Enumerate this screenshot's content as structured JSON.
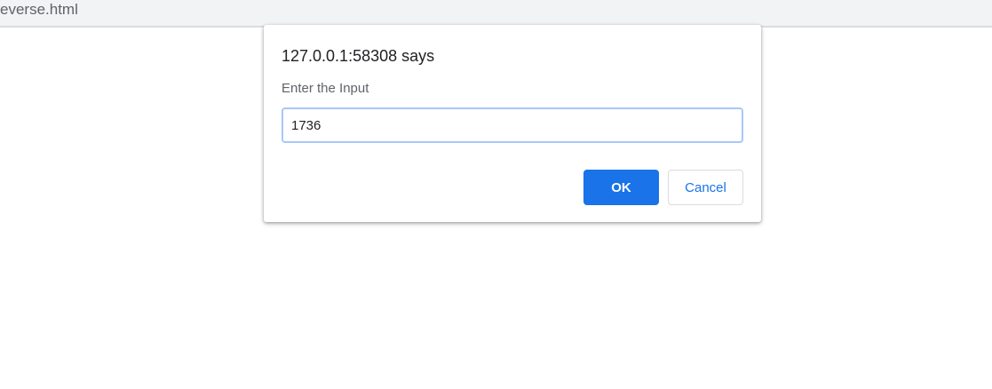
{
  "browser": {
    "address_text": "everse.html"
  },
  "dialog": {
    "title": "127.0.0.1:58308 says",
    "message": "Enter the Input",
    "input_value": "1736",
    "ok_label": "OK",
    "cancel_label": "Cancel"
  },
  "colors": {
    "accent": "#1a73e8",
    "input_focus_border": "#a8c7fa",
    "toolbar_bg": "#f1f3f4"
  }
}
